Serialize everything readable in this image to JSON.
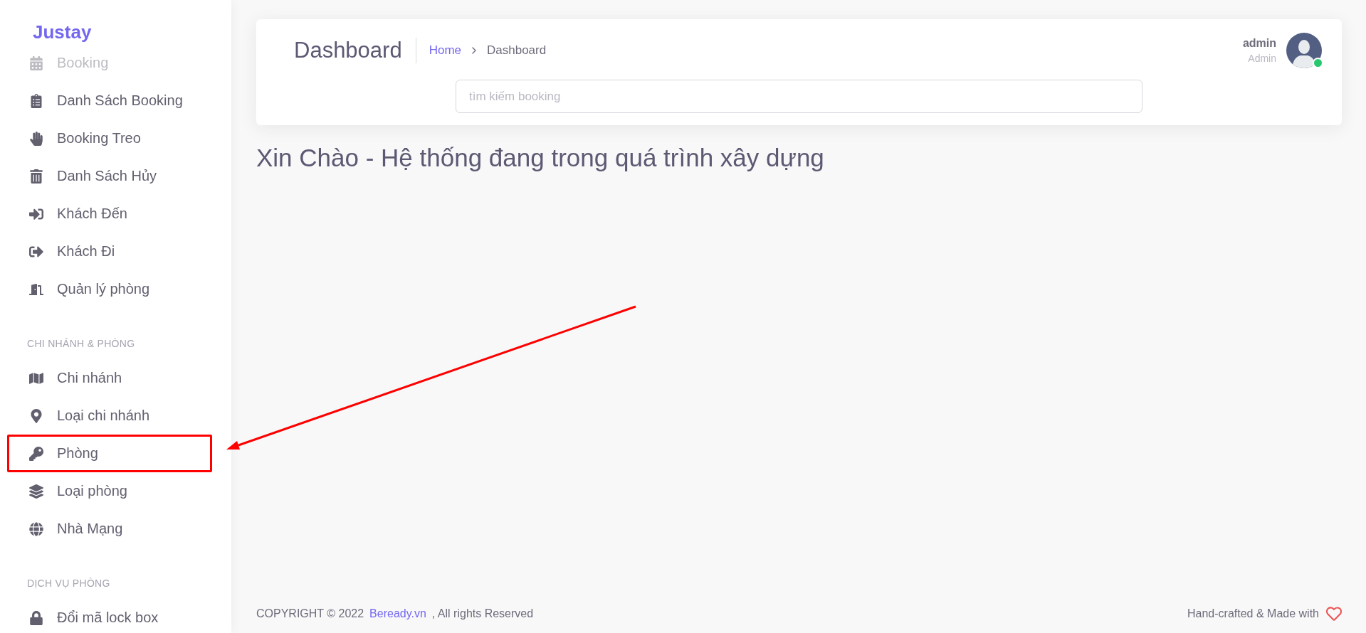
{
  "brand": "Justay",
  "sidebar": {
    "sections": [
      {
        "items": [
          {
            "label": "Booking",
            "faded": true,
            "highlighted": false
          },
          {
            "label": "Danh Sách Booking",
            "faded": false,
            "highlighted": false
          },
          {
            "label": "Booking Treo",
            "faded": false,
            "highlighted": false
          },
          {
            "label": "Danh Sách Hủy",
            "faded": false,
            "highlighted": false
          },
          {
            "label": "Khách Đến",
            "faded": false,
            "highlighted": false
          },
          {
            "label": "Khách Đi",
            "faded": false,
            "highlighted": false
          },
          {
            "label": "Quản lý phòng",
            "faded": false,
            "highlighted": false
          }
        ]
      },
      {
        "title": "CHI NHÁNH & PHÒNG",
        "items": [
          {
            "label": "Chi nhánh",
            "faded": false,
            "highlighted": false
          },
          {
            "label": "Loại chi nhánh",
            "faded": false,
            "highlighted": false
          },
          {
            "label": "Phòng",
            "faded": false,
            "highlighted": true
          },
          {
            "label": "Loại phòng",
            "faded": false,
            "highlighted": false
          },
          {
            "label": "Nhà Mạng",
            "faded": false,
            "highlighted": false
          }
        ]
      },
      {
        "title": "DỊCH VỤ PHÒNG",
        "items": [
          {
            "label": "Đổi mã lock box",
            "faded": false,
            "highlighted": false
          }
        ]
      }
    ]
  },
  "header": {
    "title": "Dashboard",
    "breadcrumb": [
      {
        "label": "Home",
        "link": true
      },
      {
        "label": "Dashboard",
        "link": false
      }
    ],
    "search": {
      "placeholder": "tìm kiếm booking"
    },
    "user": {
      "name": "admin",
      "role": "Admin",
      "online": true
    }
  },
  "content": {
    "heading": "Xin Chào - Hệ thống đang trong quá trình xây dựng"
  },
  "footer": {
    "copyright": "COPYRIGHT © 2022",
    "link": "Beready.vn",
    "rights": ", All rights Reserved",
    "credit": "Hand-crafted & Made with"
  }
}
